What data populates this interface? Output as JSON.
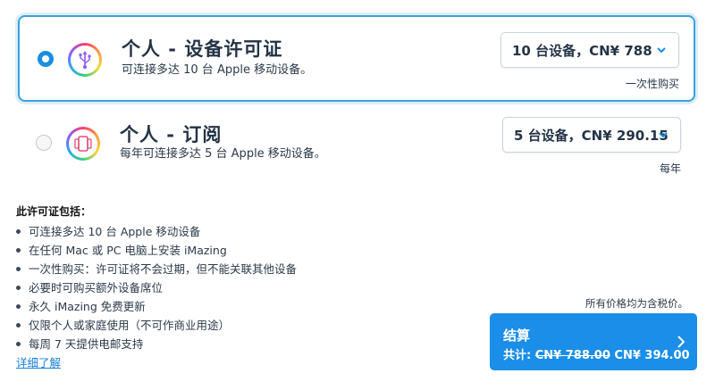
{
  "options": [
    {
      "title": "个人 - 设备许可证",
      "subtitle": "可连接多达 10 台 Apple 移动设备。",
      "select_value": "10 台设备，CN¥ 788",
      "note": "一次性购买",
      "selected": true,
      "icon": "usb-icon"
    },
    {
      "title": "个人 - 订阅",
      "subtitle": "每年可连接多达 5 台 Apple 移动设备。",
      "select_value": "5 台设备，CN¥ 290.15",
      "note": "每年",
      "selected": false,
      "icon": "devices-icon"
    }
  ],
  "features": {
    "heading": "此许可证包括：",
    "items": [
      "可连接多达 10 台 Apple 移动设备",
      "在任何 Mac 或 PC 电脑上安装 iMazing",
      "一次性购买：许可证将不会过期，但不能关联其他设备",
      "必要时可购买额外设备席位",
      "永久 iMazing 免费更新",
      "仅限个人或家庭使用（不可作商业用途）",
      "每周 7 天提供电邮支持"
    ],
    "learn_more": "详细了解"
  },
  "checkout": {
    "tax_note": "所有价格均为含税价。",
    "label": "结算",
    "total_prefix": "共计: ",
    "old_price": "CN¥ 788.00",
    "new_price": " CN¥ 394.00"
  },
  "colors": {
    "accent": "#1a8ee8",
    "selected_border": "#3aa0e0",
    "link": "#1a7fd6"
  }
}
